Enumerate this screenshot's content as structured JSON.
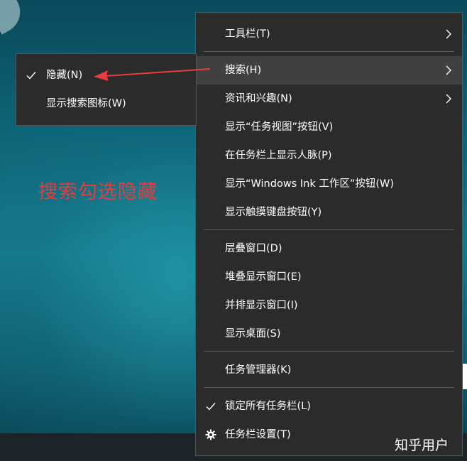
{
  "annotation": {
    "text": "搜索勾选隐藏",
    "color": "#e53d3d"
  },
  "watermark": "知乎用户",
  "main_menu": {
    "items": [
      {
        "label": "工具栏(T)",
        "submenu": true
      },
      {
        "label": "搜索(H)",
        "submenu": true,
        "hovered": true
      },
      {
        "label": "资讯和兴趣(N)",
        "submenu": true
      },
      {
        "label": "显示“任务视图”按钮(V)"
      },
      {
        "label": "在任务栏上显示人脉(P)"
      },
      {
        "label": "显示“Windows Ink 工作区”按钮(W)"
      },
      {
        "label": "显示触摸键盘按钮(Y)"
      },
      {
        "label": "层叠窗口(D)"
      },
      {
        "label": "堆叠显示窗口(E)"
      },
      {
        "label": "并排显示窗口(I)"
      },
      {
        "label": "显示桌面(S)"
      },
      {
        "label": "任务管理器(K)"
      },
      {
        "label": "锁定所有任务栏(L)",
        "checked": true
      },
      {
        "label": "任务栏设置(T)",
        "icon": "gear-icon"
      }
    ]
  },
  "sub_menu": {
    "items": [
      {
        "label": "隐藏(N)",
        "checked": true
      },
      {
        "label": "显示搜索图标(W)"
      }
    ]
  },
  "colors": {
    "menu_bg": "#2b2b2b",
    "hover_bg": "#414141",
    "arrow": "#e53d3d"
  }
}
